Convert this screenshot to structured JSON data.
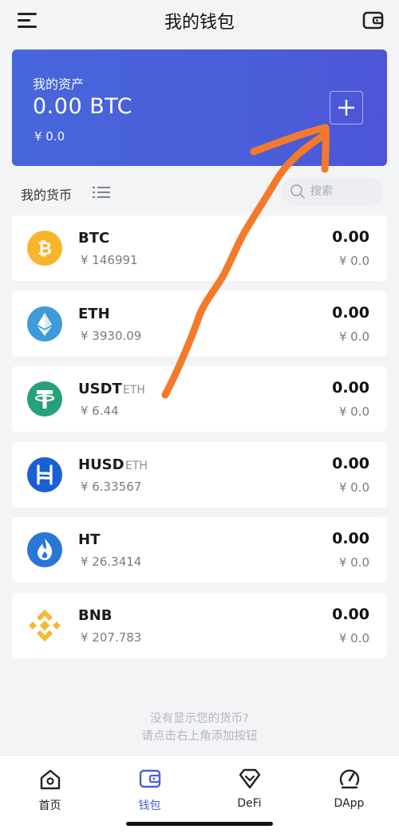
{
  "header": {
    "title": "我的钱包",
    "menu_icon": "menu-icon",
    "wallet_icon": "wallet-icon"
  },
  "asset_card": {
    "label": "我的资产",
    "total": "0.00 BTC",
    "fiat": "¥ 0.0",
    "add_icon": "plus-icon",
    "background_color": "#4a5fda"
  },
  "section": {
    "title": "我的货币",
    "search_placeholder": "搜索"
  },
  "coins": [
    {
      "symbol": "BTC",
      "chain": "",
      "price": "¥ 146991",
      "amount": "0.00",
      "value": "¥ 0.0",
      "icon": "bitcoin-icon",
      "color": "#f7b52c"
    },
    {
      "symbol": "ETH",
      "chain": "",
      "price": "¥ 3930.09",
      "amount": "0.00",
      "value": "¥ 0.0",
      "icon": "ethereum-icon",
      "color": "#3e9ad8"
    },
    {
      "symbol": "USDT",
      "chain": "ETH",
      "price": "¥ 6.44",
      "amount": "0.00",
      "value": "¥ 0.0",
      "icon": "tether-icon",
      "color": "#26a17b"
    },
    {
      "symbol": "HUSD",
      "chain": "ETH",
      "price": "¥ 6.33567",
      "amount": "0.00",
      "value": "¥ 0.0",
      "icon": "husd-icon",
      "color": "#1a5fd6"
    },
    {
      "symbol": "HT",
      "chain": "",
      "price": "¥ 26.3414",
      "amount": "0.00",
      "value": "¥ 0.0",
      "icon": "huobi-token-icon",
      "color": "#2a77d8"
    },
    {
      "symbol": "BNB",
      "chain": "",
      "price": "¥ 207.783",
      "amount": "0.00",
      "value": "¥ 0.0",
      "icon": "binance-coin-icon",
      "color": "#f3ba2f"
    }
  ],
  "hint": {
    "line1": "没有显示您的货币?",
    "line2": "请点击右上角添加按钮"
  },
  "tabs": [
    {
      "label": "首页",
      "icon": "home-icon",
      "active": false
    },
    {
      "label": "钱包",
      "icon": "wallet-icon",
      "active": true
    },
    {
      "label": "DeFi",
      "icon": "defi-icon",
      "active": false
    },
    {
      "label": "DApp",
      "icon": "dapp-icon",
      "active": false
    }
  ],
  "colors": {
    "accent": "#4a5fda",
    "background": "#f3f4f6",
    "annotation_arrow": "#f47a2b"
  }
}
